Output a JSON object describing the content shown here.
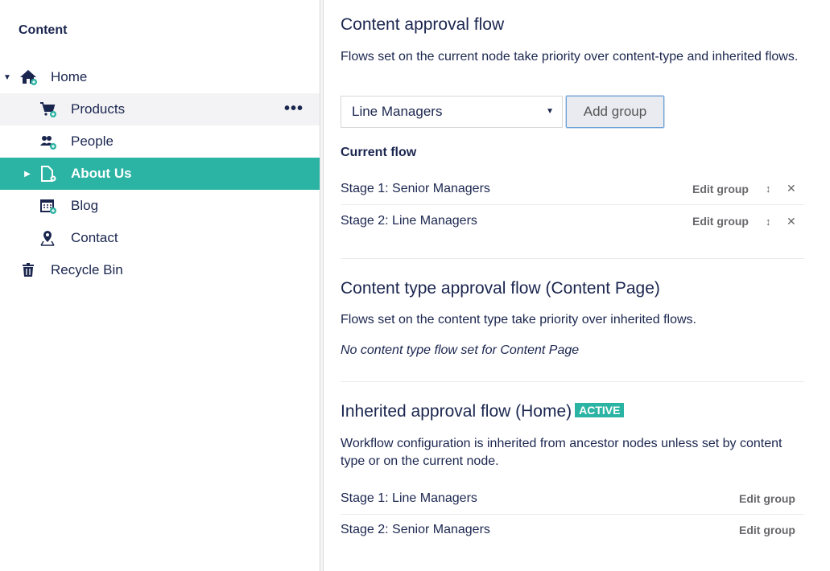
{
  "sidebar": {
    "title": "Content",
    "items": [
      {
        "label": "Home",
        "icon": "home-icon"
      },
      {
        "label": "Products",
        "icon": "cart-icon"
      },
      {
        "label": "People",
        "icon": "users-icon"
      },
      {
        "label": "About Us",
        "icon": "document-icon"
      },
      {
        "label": "Blog",
        "icon": "calendar-icon"
      },
      {
        "label": "Contact",
        "icon": "map-pin-icon"
      },
      {
        "label": "Recycle Bin",
        "icon": "trash-icon"
      }
    ],
    "more_actions": "•••"
  },
  "content_flow": {
    "title": "Content approval flow",
    "description": "Flows set on the current node take priority over content-type and inherited flows.",
    "select_value": "Line Managers",
    "add_group_label": "Add group",
    "current_flow_label": "Current flow",
    "stages": [
      {
        "label": "Stage 1: Senior Managers",
        "edit": "Edit group"
      },
      {
        "label": "Stage 2: Line Managers",
        "edit": "Edit group"
      }
    ]
  },
  "content_type_flow": {
    "title": "Content type approval flow (Content Page)",
    "description": "Flows set on the content type take priority over inherited flows.",
    "empty_note": "No content type flow set for Content Page"
  },
  "inherited_flow": {
    "title": "Inherited approval flow (Home)",
    "badge": "ACTIVE",
    "description": "Workflow configuration is inherited from ancestor nodes unless set by content type or on the current node.",
    "stages": [
      {
        "label": "Stage 1: Line Managers",
        "edit": "Edit group"
      },
      {
        "label": "Stage 2: Senior Managers",
        "edit": "Edit group"
      }
    ]
  },
  "colors": {
    "accent": "#2bb3a3",
    "text": "#1b264f",
    "muted": "#68676b"
  }
}
